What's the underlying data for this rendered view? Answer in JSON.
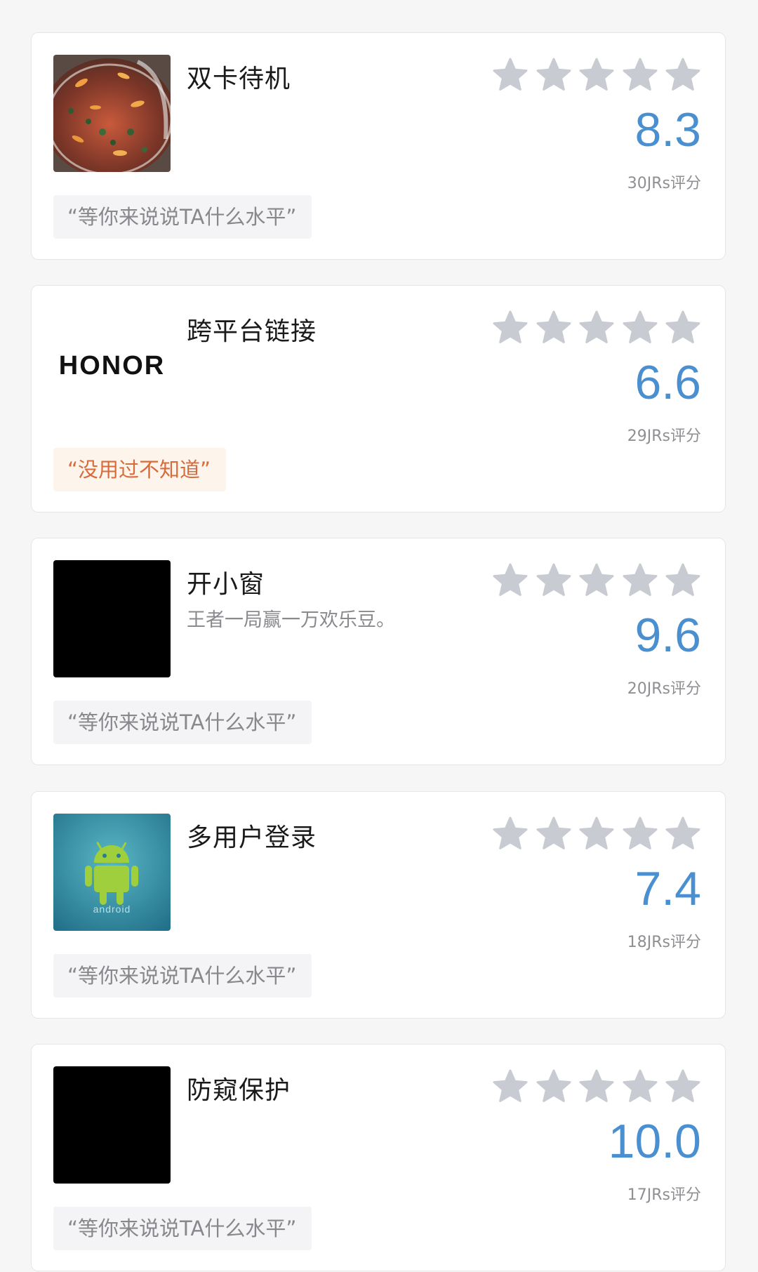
{
  "colors": {
    "score": "#4a90d0",
    "star": "#c9cbd3",
    "quote_default": "#88888c",
    "quote_warm": "#d96a3a"
  },
  "star_icon": "star-icon",
  "cards": [
    {
      "title": "双卡待机",
      "subtitle": "",
      "thumbnail": "goldfish-bowl-photo",
      "stars": 5,
      "score": "8.3",
      "raters": "30JRs评分",
      "quote": "“等你来说说TA什么水平”",
      "quote_style": "default"
    },
    {
      "title": "跨平台链接",
      "subtitle": "",
      "thumbnail": "honor-logo",
      "logo_text": "HONOR",
      "stars": 5,
      "score": "6.6",
      "raters": "29JRs评分",
      "quote": "“没用过不知道”",
      "quote_style": "warm"
    },
    {
      "title": "开小窗",
      "subtitle": "王者一局赢一万欢乐豆。",
      "thumbnail": "black-image",
      "stars": 5,
      "score": "9.6",
      "raters": "20JRs评分",
      "quote": "“等你来说说TA什么水平”",
      "quote_style": "default"
    },
    {
      "title": "多用户登录",
      "subtitle": "",
      "thumbnail": "android-logo",
      "logo_text": "android",
      "stars": 5,
      "score": "7.4",
      "raters": "18JRs评分",
      "quote": "“等你来说说TA什么水平”",
      "quote_style": "default"
    },
    {
      "title": "防窥保护",
      "subtitle": "",
      "thumbnail": "black-image",
      "stars": 5,
      "score": "10.0",
      "raters": "17JRs评分",
      "quote": "“等你来说说TA什么水平”",
      "quote_style": "default"
    }
  ]
}
